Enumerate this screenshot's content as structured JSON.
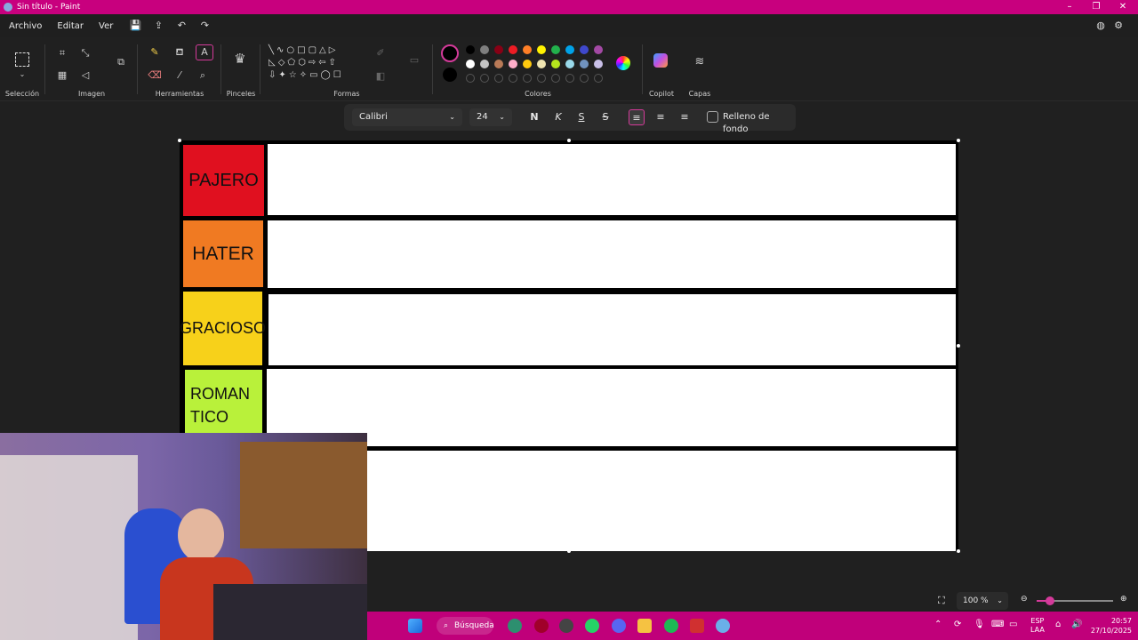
{
  "window": {
    "title": "Sin título - Paint"
  },
  "menu": {
    "items": [
      "Archivo",
      "Editar",
      "Ver"
    ]
  },
  "ribbon": {
    "groups": {
      "seleccion": "Selección",
      "imagen": "Imagen",
      "herramientas": "Herramientas",
      "pinceles": "Pinceles",
      "formas": "Formas",
      "colores": "Colores",
      "copilot": "Copilot",
      "capas": "Capas"
    },
    "palette_row1": [
      "#000000",
      "#7f7f7f",
      "#880015",
      "#ed1c24",
      "#ff7f27",
      "#fff200",
      "#22b14c",
      "#00a2e8",
      "#3f48cc",
      "#a349a4"
    ],
    "palette_row2": [
      "#ffffff",
      "#c3c3c3",
      "#b97a57",
      "#ffaec9",
      "#ffc90e",
      "#efe4b0",
      "#b5e61d",
      "#99d9ea",
      "#7092be",
      "#c8bfe7"
    ]
  },
  "text_format": {
    "font": "Calibri",
    "size": "24",
    "bold": "N",
    "italic": "K",
    "underline": "S",
    "strike": "S",
    "fill_label": "Relleno de fondo"
  },
  "tiers": [
    {
      "lines": [
        "PAJERO"
      ],
      "color": "#e0101f"
    },
    {
      "lines": [
        "HATER"
      ],
      "color": "#f07a22"
    },
    {
      "lines": [
        "GRACIOSO"
      ],
      "color": "#f7d11a"
    },
    {
      "lines": [
        "ROMAN",
        "TICO"
      ],
      "color": "#b9f13a"
    },
    {
      "lines": [
        ""
      ],
      "color": "#ffffff"
    }
  ],
  "status": {
    "zoom": "100 %"
  },
  "taskbar": {
    "search": "Búsqueda",
    "lang1": "ESP",
    "lang2": "LAA",
    "time": "20:57",
    "date": "27/10/2025"
  }
}
